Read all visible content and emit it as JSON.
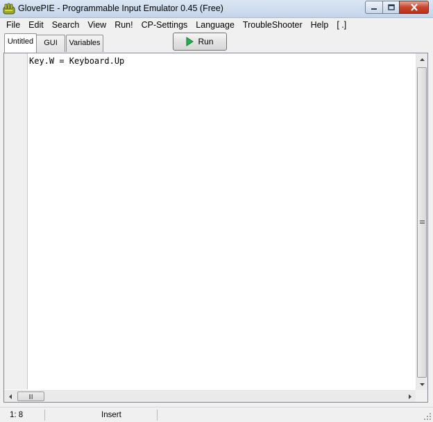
{
  "window": {
    "title": "GlovePIE - Programmable Input Emulator 0.45 (Free)",
    "icon": "glovepie-glove-icon"
  },
  "menu": [
    {
      "label": "File"
    },
    {
      "label": "Edit"
    },
    {
      "label": "Search"
    },
    {
      "label": "View"
    },
    {
      "label": "Run!"
    },
    {
      "label": "CP-Settings"
    },
    {
      "label": "Language"
    },
    {
      "label": "TroubleShooter"
    },
    {
      "label": "Help"
    },
    {
      "label": "[ .]"
    }
  ],
  "tabs": [
    {
      "label": "Untitled",
      "active": true
    },
    {
      "label": "GUI",
      "active": false
    },
    {
      "label": "Variables",
      "active": false
    }
  ],
  "toolbar": {
    "run_label": "Run",
    "run_icon": "play-icon",
    "run_icon_color": "#22b14c"
  },
  "editor": {
    "lines": [
      "Key.W = Keyboard.Up"
    ]
  },
  "statusbar": {
    "cursor_position": "1: 8",
    "mode": "Insert"
  },
  "colors": {
    "close_button": "#c8462d",
    "titlebar": "#c4d5ea"
  }
}
